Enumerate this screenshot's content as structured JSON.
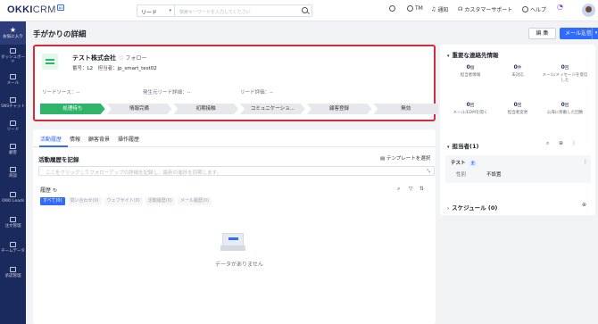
{
  "topbar": {
    "logo_main": "OKKI",
    "logo_sub": "CRM",
    "logo_badge": "AI",
    "search_scope": "リード",
    "search_placeholder": "検索キーワードを入力してください",
    "user_short": "TM",
    "notify_label": "通知",
    "support_label": "カスタマーサポート",
    "help_label": "ヘルプ"
  },
  "sidebar": {
    "items": [
      {
        "label": "お気に入り",
        "icon": "star-icon"
      },
      {
        "label": "ダッシュボード",
        "icon": "dashboard-icon"
      },
      {
        "label": "メール",
        "icon": "mail-icon"
      },
      {
        "label": "SNSチャット",
        "icon": "chat-icon"
      },
      {
        "label": "リード",
        "icon": "lead-icon"
      },
      {
        "label": "顧客",
        "icon": "customer-icon"
      },
      {
        "label": "商談",
        "icon": "deal-icon"
      },
      {
        "label": "OKKI Leads",
        "icon": "okki-leads-icon"
      },
      {
        "label": "注文管理",
        "icon": "order-icon"
      },
      {
        "label": "チームデータ",
        "icon": "team-data-icon"
      },
      {
        "label": "承認管理",
        "icon": "approval-icon"
      }
    ]
  },
  "page": {
    "title": "手がかりの詳細",
    "edit_label": "編 集",
    "mail_label": "メール送信"
  },
  "lead": {
    "company": "テスト株式会社",
    "follow_label": "フォロー",
    "number_label": "番号：",
    "number": "L2",
    "owner_label": "担当者：",
    "owner": "jp_smart_test02",
    "source_label": "リードソース：--",
    "origin_label": "発生元リード詳細：--",
    "rating_label": "リード評価：--",
    "stages": [
      "処理待ち",
      "情報完備",
      "初期接触",
      "コミュニケーショ...",
      "顧客登録",
      "無効"
    ],
    "current_stage": 0
  },
  "activity": {
    "tabs": [
      "活動履歴",
      "情報",
      "顧客背景",
      "操作履歴"
    ],
    "record_title": "活動履歴を記録",
    "template_label": "テンプレートを選択",
    "textarea_placeholder": "ここをクリックしてフォローアップの詳細を記録し、最新の進捗を同期します。",
    "history_title": "履歴",
    "filters": [
      "すべて(0)",
      "問い合わせ(0)",
      "ウェブサイト(0)",
      "活動履歴(0)",
      "メール履歴(0)"
    ],
    "empty_text": "データがありません"
  },
  "contact_info": {
    "title": "重要な連絡先情報",
    "stats": [
      {
        "value": "0",
        "unit": "個",
        "label": "担当者情報"
      },
      {
        "value": "0",
        "unit": "件",
        "label": "未対応"
      },
      {
        "value": "0",
        "unit": "回",
        "label": "メール/メッセージを受信した"
      },
      {
        "value": "0",
        "unit": "回",
        "label": "メール/EDMを開く"
      },
      {
        "value": "0",
        "unit": "回",
        "label": "担当者変更"
      },
      {
        "value": "0",
        "unit": "回",
        "label": "公海に移動した回数"
      }
    ]
  },
  "owners": {
    "title": "担当者(1)",
    "name": "テスト",
    "tag": "主",
    "gender_label": "性別",
    "gender_value": "不設置"
  },
  "schedule": {
    "title": "スケジュール (0)"
  }
}
